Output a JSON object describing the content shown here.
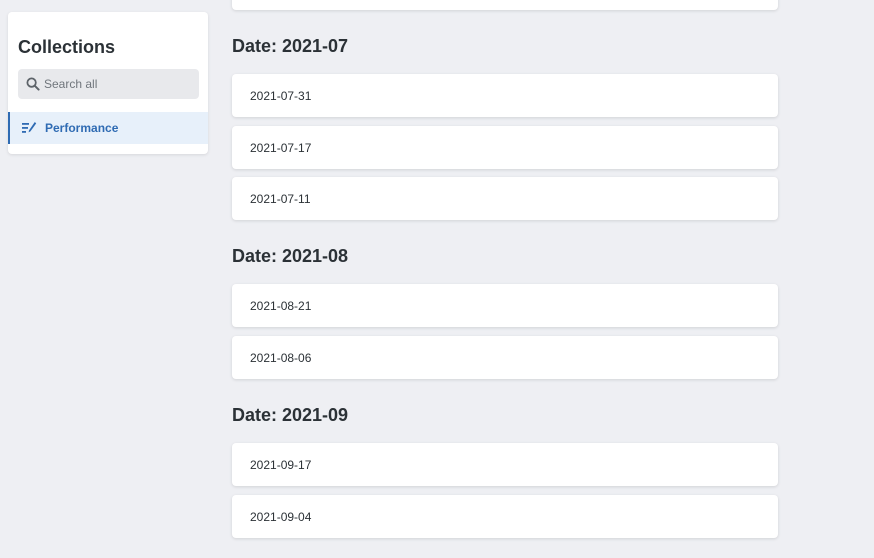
{
  "sidebar": {
    "title": "Collections",
    "search_placeholder": "Search all",
    "items": [
      {
        "label": "Performance",
        "icon": "edit-list-icon",
        "active": true
      }
    ]
  },
  "groups": [
    {
      "heading": "Date: 2021-07",
      "entries": [
        "2021-07-31",
        "2021-07-17",
        "2021-07-11"
      ]
    },
    {
      "heading": "Date: 2021-08",
      "entries": [
        "2021-08-21",
        "2021-08-06"
      ]
    },
    {
      "heading": "Date: 2021-09",
      "entries": [
        "2021-09-17",
        "2021-09-04"
      ]
    }
  ],
  "colors": {
    "background": "#eeeff3",
    "accent": "#2f6bb3",
    "active_bg": "#e7f0fa",
    "card": "#ffffff",
    "text": "#2b3136"
  }
}
